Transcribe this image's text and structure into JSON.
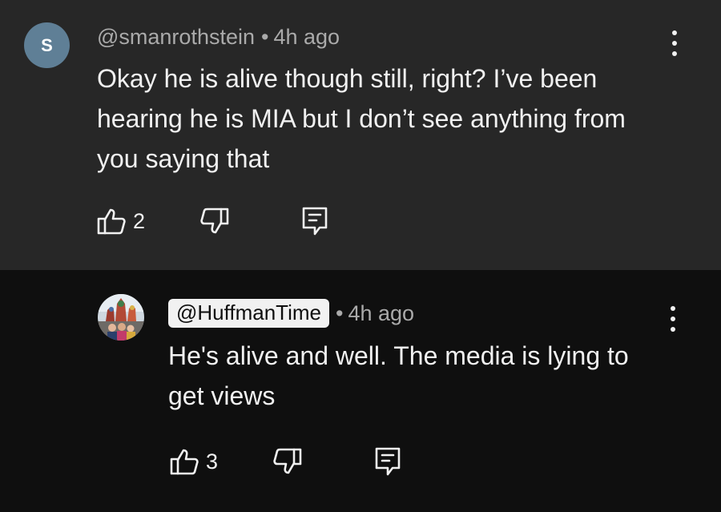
{
  "comments": [
    {
      "author": "@smanrothstein",
      "avatar_letter": "S",
      "separator": "•",
      "time": "4h ago",
      "text": "Okay he is alive though still, right? I’ve been hearing he is MIA but I don’t see anything from you saying that",
      "likes": "2"
    },
    {
      "author": "@HuffmanTime",
      "separator": "•",
      "time": "4h ago",
      "text": "He's alive and well.  The media is lying to get views",
      "likes": "3"
    }
  ],
  "icons": {
    "like": "thumbs-up-icon",
    "dislike": "thumbs-down-icon",
    "reply": "reply-icon",
    "menu": "more-vert-icon"
  },
  "colors": {
    "highlighted_background": "#272727",
    "page_background": "#0f0f0f",
    "text": "#f1f1f1",
    "meta_text": "#aaaaaa",
    "avatar_bg": "#5f7f96"
  }
}
